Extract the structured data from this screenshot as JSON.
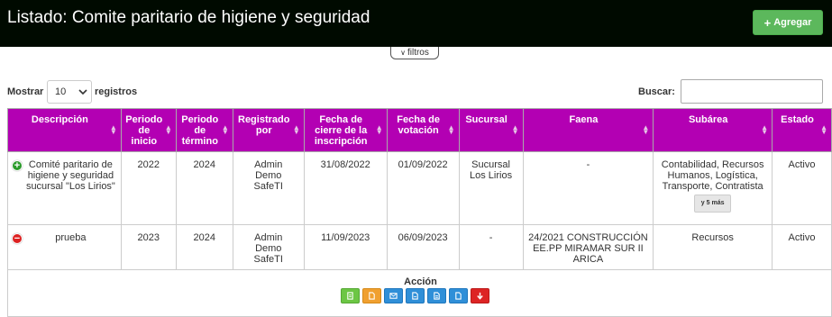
{
  "header": {
    "title": "Listado: Comite paritario de higiene y seguridad",
    "add_label": "Agregar"
  },
  "filters": {
    "label": "filtros"
  },
  "controls": {
    "show_label": "Mostrar",
    "page_size": "10",
    "registros_label": "registros",
    "search_label": "Buscar:",
    "search_value": ""
  },
  "table": {
    "columns": [
      "Descripción",
      "Periodo de inicio",
      "Periodo de término",
      "Registrado por",
      "Fecha de cierre de la inscripción",
      "Fecha de votación",
      "Sucursal",
      "Faena",
      "Subárea",
      "Estado"
    ],
    "rows": [
      {
        "descripcion": "Comité paritario de higiene y seguridad sucursal \"Los Lirios\"",
        "inicio": "2022",
        "termino": "2024",
        "registrado": "Admin Demo SafeTI",
        "cierre": "31/08/2022",
        "votacion": "01/09/2022",
        "sucursal": "Sucursal Los Lirios",
        "faena": "-",
        "subarea": "Contabilidad, Recursos Humanos, Logística, Transporte, Contratista",
        "subarea_more": "y 5 más",
        "estado": "Activo"
      },
      {
        "descripcion": "prueba",
        "inicio": "2023",
        "termino": "2024",
        "registrado": "Admin Demo SafeTI",
        "cierre": "11/09/2023",
        "votacion": "06/09/2023",
        "sucursal": "-",
        "faena": "24/2021 CONSTRUCCIÓN EE.PP MIRAMAR SUR II ARICA",
        "subarea": "Recursos",
        "estado": "Activo"
      }
    ]
  },
  "accion": {
    "label": "Acción"
  },
  "colors": {
    "header_bg": "#000a00",
    "table_header": "#b300b3",
    "add_button": "#5cb85c"
  }
}
